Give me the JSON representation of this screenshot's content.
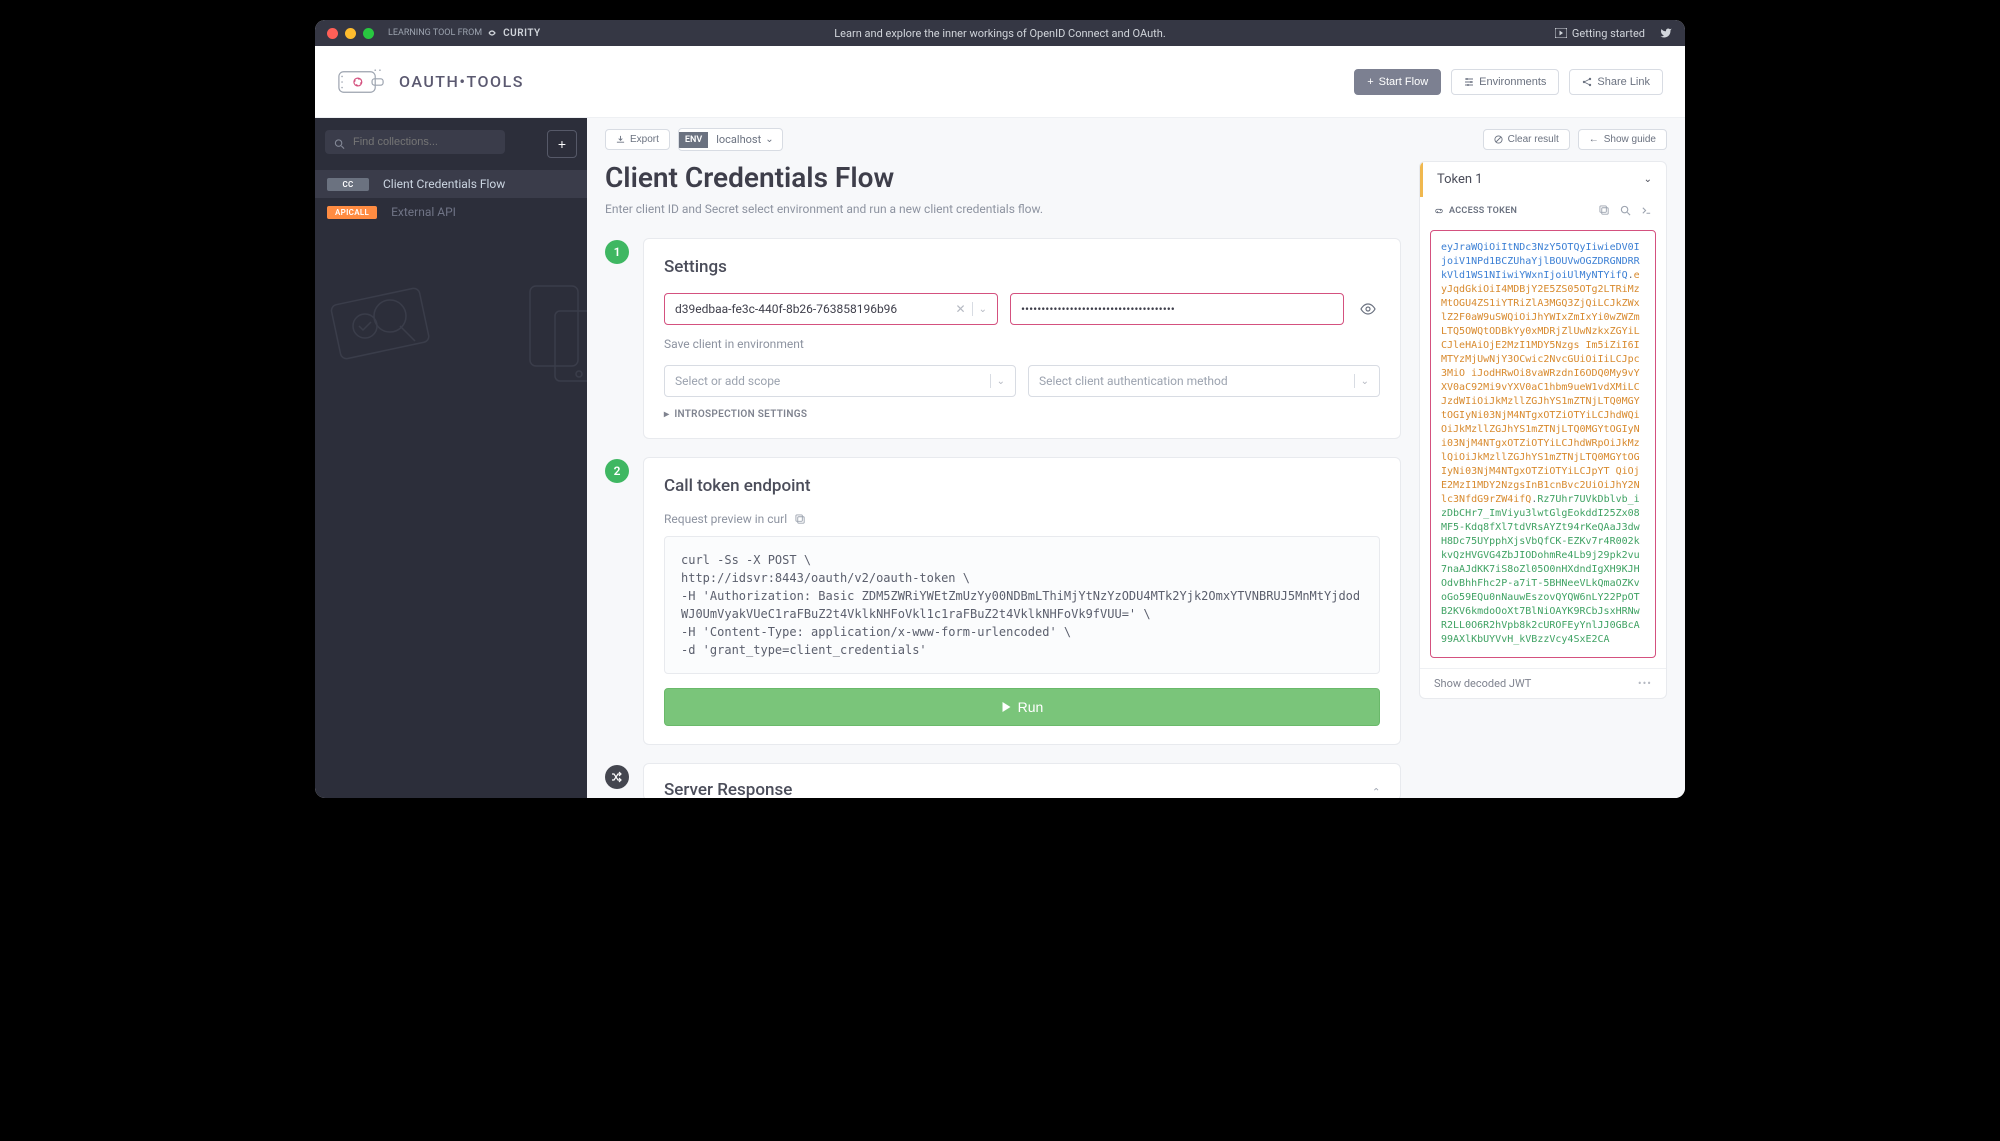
{
  "titlebar": {
    "learning_label": "LEARNING TOOL FROM",
    "brand": "CURITY",
    "tagline": "Learn and explore the inner workings of OpenID Connect and OAuth.",
    "getting_started": "Getting started"
  },
  "header": {
    "logo_text": "OAUTH•TOOLS",
    "start_flow": "Start Flow",
    "environments": "Environments",
    "share_link": "Share Link"
  },
  "sidebar": {
    "search_placeholder": "Find collections...",
    "items": [
      {
        "tag": "CC",
        "label": "Client Credentials Flow",
        "active": true
      },
      {
        "tag": "APICALL",
        "label": "External API",
        "active": false
      }
    ]
  },
  "toolbar": {
    "export": "Export",
    "env_badge": "ENV",
    "env_value": "localhost",
    "clear_result": "Clear result",
    "show_guide": "Show guide"
  },
  "page": {
    "title": "Client Credentials Flow",
    "subtitle": "Enter client ID and Secret select environment and run a new client credentials flow."
  },
  "step1": {
    "num": "1",
    "title": "Settings",
    "client_id": "d39edbaa-fe3c-440f-8b26-763858196b96",
    "secret_mask": "••••••••••••••••••••••••••••••••••••••",
    "save_link": "Save client in environment",
    "scope_placeholder": "Select or add scope",
    "auth_method_placeholder": "Select client authentication method",
    "introspection": "INTROSPECTION SETTINGS"
  },
  "step2": {
    "num": "2",
    "title": "Call token endpoint",
    "req_label": "Request preview in curl",
    "curl": "curl -Ss -X POST \\\nhttp://idsvr:8443/oauth/v2/oauth-token \\\n-H 'Authorization: Basic ZDM5ZWRiYWEtZmUzYy00NDBmLThiMjYtNzYzODU4MTk2Yjk2OmxYTVNBRUJ5MnMtYjdodWJ0UmVyakVUeC1raFBuZ2t4VklkNHFoVkl1c1raFBuZ2t4VklkNHFoVk9fVUU=' \\\n-H 'Content-Type: application/x-www-form-urlencoded' \\\n-d 'grant_type=client_credentials'",
    "run": "Run"
  },
  "step3": {
    "title": "Server Response"
  },
  "token": {
    "title": "Token 1",
    "type": "ACCESS TOKEN",
    "jwt_header": "eyJraWQiOiItNDc3NzY5OTQyIiwieDV0IjoiV1NPd1BCZUhaYjlBOUVwOGZDRGNDRRkVld1WS1NIiwiYWxnIjoiUlMyNTYifQ",
    "jwt_payload": "eyJqdGkiOiI4MDBjY2E5ZS05OTg2LTRiMzMtOGU4ZS1iYTRiZlA3MGQ3ZjQiLCJkZWxlZ2F0aW9uSWQiOiJhYWIxZmIxYi0wZWZmLTQ5OWQtODBkYy0xMDRjZlUwNzkxZGYiLCJleHAiOjE2MzI1MDY5Nzgs Im5iZiI6IMTYzMjUwNjY3OCwic2NvcGUiOiIiLCJpc3MiO iJodHRwOi8vaWRzdnI6ODQ0My9vYXV0aC92Mi9vYXV0aC1hbm9ueW1vdXMiLCJzdWIiOiJkMzllZGJhYS1mZTNjLTQ0MGYtOGIyNi03NjM4NTgxOTZiOTYiLCJhdWQiOiJkMzllZGJhYS1mZTNjLTQ0MGYtOGIyNi03NjM4NTgxOTZiOTYiLCJhdWRpOiJkMzlQiOiJkMzllZGJhYS1mZTNjLTQ0MGYtOGIyNi03NjM4NTgxOTZiOTYiLCJpYT QiOjE2MzI1MDY2NzgsInB1cnBvc2UiOiJhY2N lc3NfdG9rZW4ifQ",
    "jwt_sig": "Rz7Uhr7UVkDblvb_izDbCHr7_ImViyu3lwtGlgEokddI25Zx08MF5-Kdq8fXl7tdVRsAYZt94rKeQAaJ3dwH8Dc75UYpphXjsVbQfCK-EZKv7r4R002kkvQzHVGVG4ZbJIODohmRe4Lb9j29pk2vu7naAJdKK7iS8oZl05O0nHXdndIgXH9KJHOdvBhhFhc2P-a7iT-5BHNeeVLkQmaOZKvoGo59EQu0nNauwEszovQYQW6nLY22PpOTB2KV6kmdoOoXt7BlNiOAYK9RCbJsxHRNwR2LL0O6R2hVpb8k2cUROFEyYnlJJ0GBcA99AXlKbUYVvH_kVBzzVcy4SxE2CA",
    "decoded": "Show decoded JWT"
  }
}
